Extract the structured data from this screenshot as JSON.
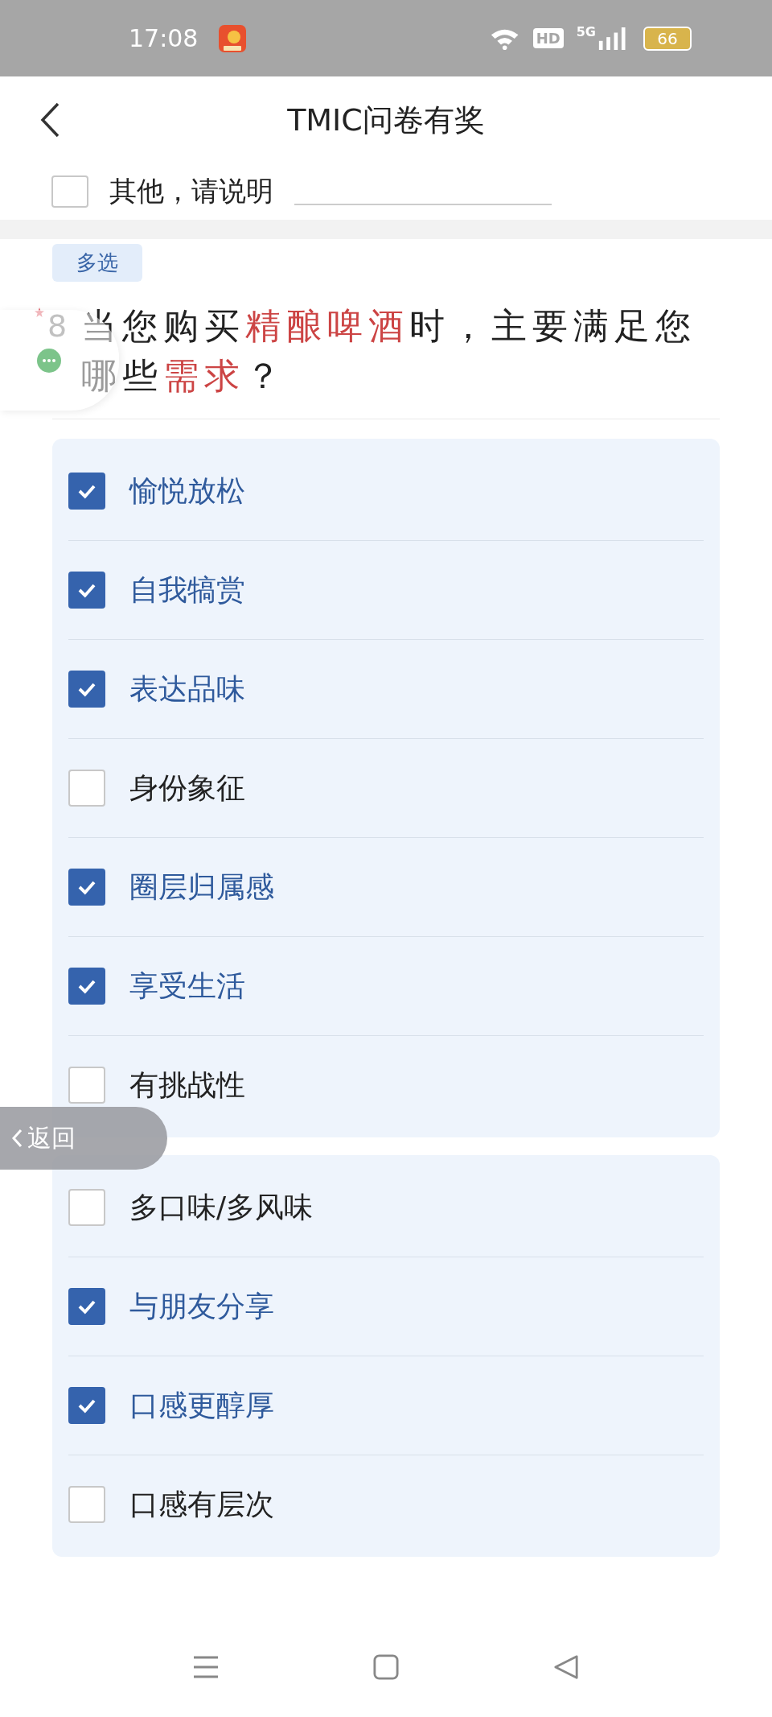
{
  "status_bar": {
    "time": "17:08",
    "hd": "HD",
    "network": "5G",
    "battery": "66"
  },
  "header": {
    "title": "TMIC问卷有奖"
  },
  "previous_option": {
    "label": "其他，请说明",
    "checked": false
  },
  "question": {
    "tag": "多选",
    "required": true,
    "number": "8",
    "text": "当您购买**精酿啤酒**时，主要满足您哪些**需求**？"
  },
  "option_groups": [
    {
      "options": [
        {
          "label": "愉悦放松",
          "checked": true
        },
        {
          "label": "自我犒赏",
          "checked": true
        },
        {
          "label": "表达品味",
          "checked": true
        },
        {
          "label": "身份象征",
          "checked": false
        },
        {
          "label": "圈层归属感",
          "checked": true
        },
        {
          "label": "享受生活",
          "checked": true
        },
        {
          "label": "有挑战性",
          "checked": false
        }
      ]
    },
    {
      "options": [
        {
          "label": "多口味/多风味",
          "checked": false
        },
        {
          "label": "与朋友分享",
          "checked": true
        },
        {
          "label": "口感更醇厚",
          "checked": true
        },
        {
          "label": "口感有层次",
          "checked": false
        }
      ]
    }
  ],
  "floating_back": {
    "label": "返回"
  }
}
